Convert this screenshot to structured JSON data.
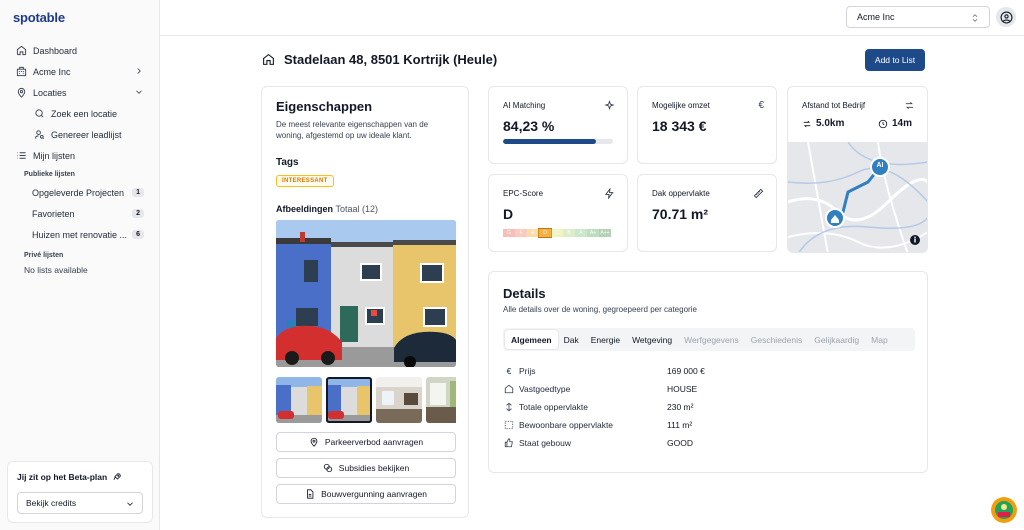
{
  "app": {
    "logo": "spotable"
  },
  "sidebar": {
    "items": [
      {
        "label": "Dashboard",
        "icon": "home-icon"
      },
      {
        "label": "Acme Inc",
        "icon": "building-icon"
      },
      {
        "label": "Locaties",
        "icon": "map-pin-icon"
      },
      {
        "label": "Zoek een locatie",
        "icon": "search-icon"
      },
      {
        "label": "Genereer leadlijst",
        "icon": "user-search-icon"
      },
      {
        "label": "Mijn lijsten",
        "icon": "list-icon"
      }
    ],
    "public_label": "Publieke lijsten",
    "public_lists": [
      {
        "label": "Opgeleverde Projecten",
        "count": "1"
      },
      {
        "label": "Favorieten",
        "count": "2"
      },
      {
        "label": "Huizen met renovatie ...",
        "count": "6"
      }
    ],
    "private_label": "Privé lijsten",
    "private_empty": "No lists available",
    "beta": {
      "title": "Jij zit op het Beta-plan",
      "select_value": "Bekijk credits"
    }
  },
  "topbar": {
    "org": "Acme Inc"
  },
  "header": {
    "address": "Stadelaan 48, 8501 Kortrijk (Heule)",
    "add_button": "Add to List"
  },
  "properties": {
    "title": "Eigenschappen",
    "description": "De meest relevante eigenschappen van de woning, afgestemd op uw ideale klant.",
    "tags_title": "Tags",
    "tag": "INTERESSANT",
    "images_title": "Afbeeldingen",
    "images_total": "Totaal (12)",
    "actions": [
      {
        "label": "Parkeerverbod aanvragen",
        "icon": "map-pin-icon"
      },
      {
        "label": "Subsidies bekijken",
        "icon": "coins-icon"
      },
      {
        "label": "Bouwvergunning aanvragen",
        "icon": "file-icon"
      }
    ]
  },
  "stats": {
    "ai": {
      "title": "AI Matching",
      "value": "84,23 %",
      "progress": 0.8423
    },
    "revenue": {
      "title": "Mogelijke omzet",
      "value": "18 343 €"
    },
    "epc": {
      "title": "EPC-Score",
      "value": "D",
      "scale": [
        "G",
        "F",
        "E",
        "D",
        "C",
        "B",
        "A",
        "A+",
        "A++"
      ],
      "active": "D"
    },
    "roof": {
      "title": "Dak oppervlakte",
      "value": "70.71 m²"
    },
    "distance": {
      "title": "Afstand tot Bedrijf",
      "km": "5.0km",
      "time": "14m",
      "map_marker": "AI"
    }
  },
  "details": {
    "title": "Details",
    "description": "Alle details over de woning, gegroepeerd per categorie",
    "tabs": [
      {
        "label": "Algemeen",
        "state": "active"
      },
      {
        "label": "Dak",
        "state": "normal"
      },
      {
        "label": "Energie",
        "state": "normal"
      },
      {
        "label": "Wetgeving",
        "state": "normal"
      },
      {
        "label": "Werfgegevens",
        "state": "disabled"
      },
      {
        "label": "Geschiedenis",
        "state": "disabled"
      },
      {
        "label": "Gelijkaardig",
        "state": "disabled"
      },
      {
        "label": "Map",
        "state": "disabled"
      }
    ],
    "rows": [
      {
        "label": "Prijs",
        "value": "169 000 €",
        "icon": "euro-icon"
      },
      {
        "label": "Vastgoedtype",
        "value": "HOUSE",
        "icon": "house-icon"
      },
      {
        "label": "Totale oppervlakte",
        "value": "230 m²",
        "icon": "area-icon"
      },
      {
        "label": "Bewoonbare oppervlakte",
        "value": "111 m²",
        "icon": "expand-icon"
      },
      {
        "label": "Staat gebouw",
        "value": "GOOD",
        "icon": "thumbs-up-icon"
      }
    ]
  },
  "colors": {
    "brand": "#1e3a8a",
    "accent": "#1e4a8a",
    "tag": "#d97706"
  }
}
